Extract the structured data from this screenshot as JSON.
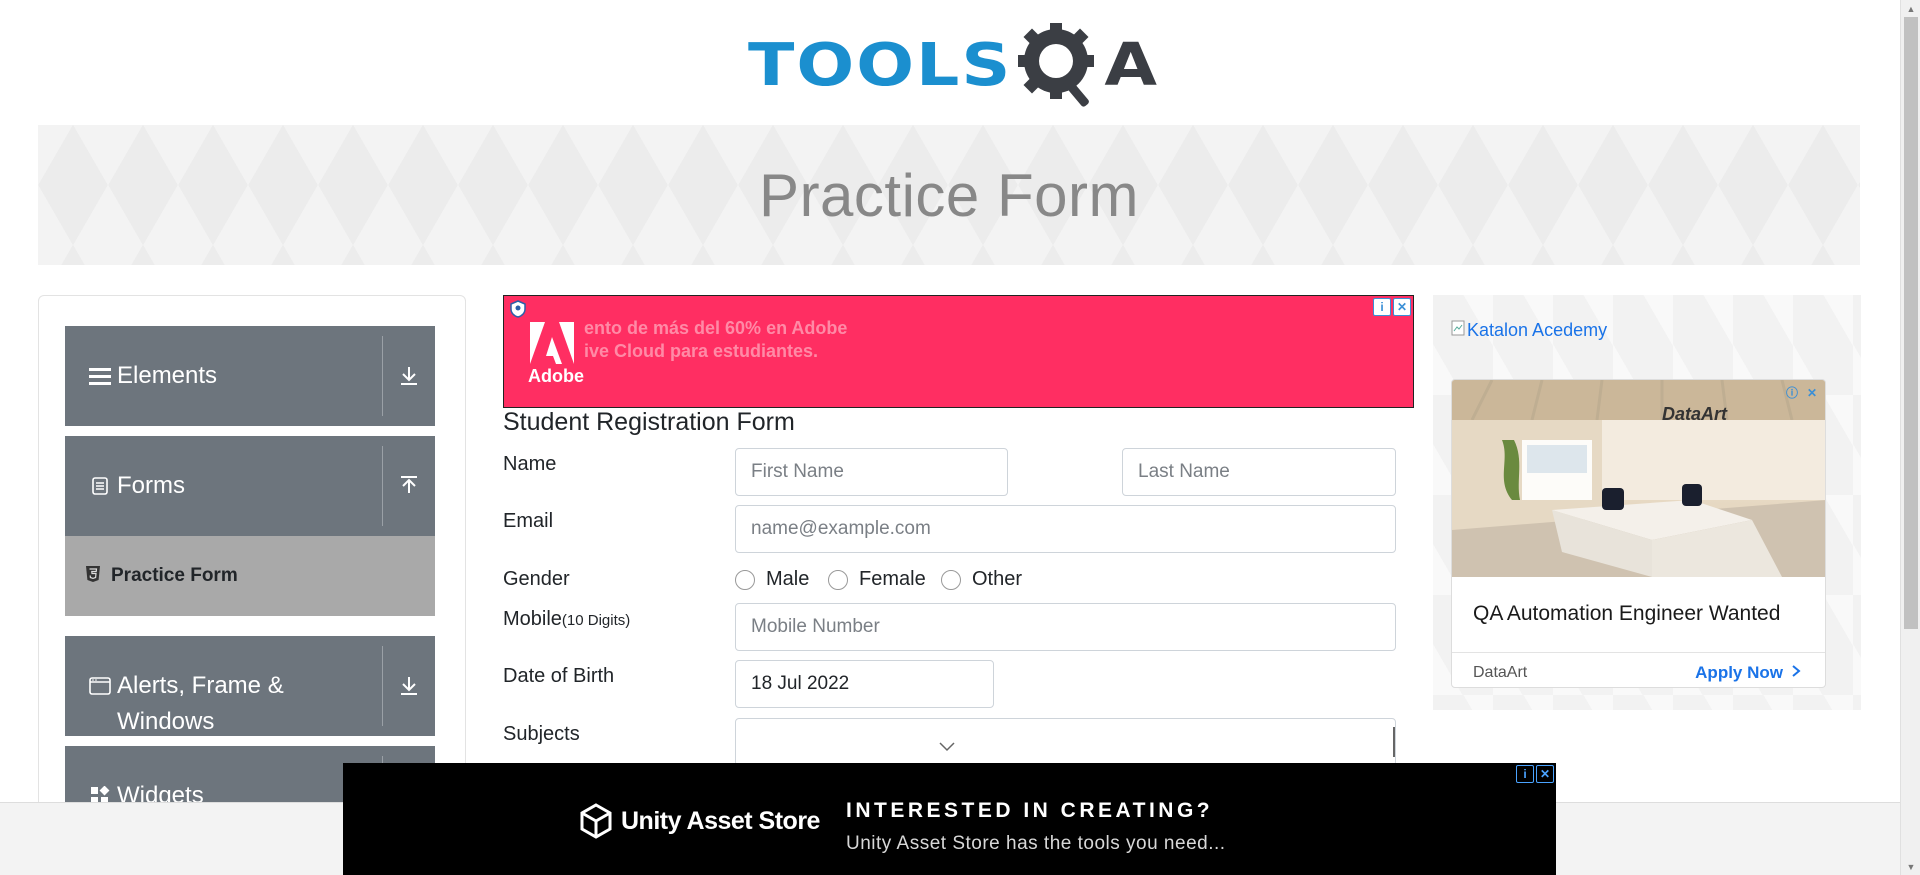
{
  "header": {
    "logo_tools": "TOOLS",
    "logo_qa_a": "A",
    "brand_color": "#1b8fcf"
  },
  "banner": {
    "title": "Practice Form"
  },
  "sidebar": {
    "groups": [
      {
        "label": "Elements",
        "icon": "hamburger-icon",
        "expanded": false
      },
      {
        "label": "Forms",
        "icon": "document-icon",
        "expanded": true
      },
      {
        "label": "Alerts, Frame &",
        "label_line2": "Windows",
        "icon": "window-icon",
        "expanded": false
      },
      {
        "label": "Widgets",
        "icon": "widgets-icon",
        "expanded": false
      }
    ],
    "active_item": {
      "label": "Practice Form",
      "icon": "html5-icon"
    }
  },
  "top_ad": {
    "line1": "ento de más del 60% en Adobe",
    "line2": "ive Cloud para estudiantes.",
    "brand": "Adobe",
    "bg_color": "#ff2e62"
  },
  "form": {
    "title": "Student Registration Form",
    "name_label": "Name",
    "first_name_placeholder": "First Name",
    "last_name_placeholder": "Last Name",
    "email_label": "Email",
    "email_placeholder": "name@example.com",
    "gender_label": "Gender",
    "gender_options": [
      "Male",
      "Female",
      "Other"
    ],
    "mobile_label": "Mobile",
    "mobile_hint": "(10 Digits)",
    "mobile_placeholder": "Mobile Number",
    "dob_label": "Date of Birth",
    "dob_value": "18 Jul 2022",
    "subjects_label": "Subjects"
  },
  "right_ad": {
    "link_text": "Katalon Acedemy",
    "logo_text": "DataArt",
    "headline": "QA Automation Engineer Wanted",
    "brand": "DataArt",
    "cta": "Apply Now"
  },
  "bottom_ad": {
    "brand": "Unity Asset Store",
    "headline": "INTERESTED IN CREATING?",
    "subline": "Unity Asset Store has the tools you need..."
  }
}
